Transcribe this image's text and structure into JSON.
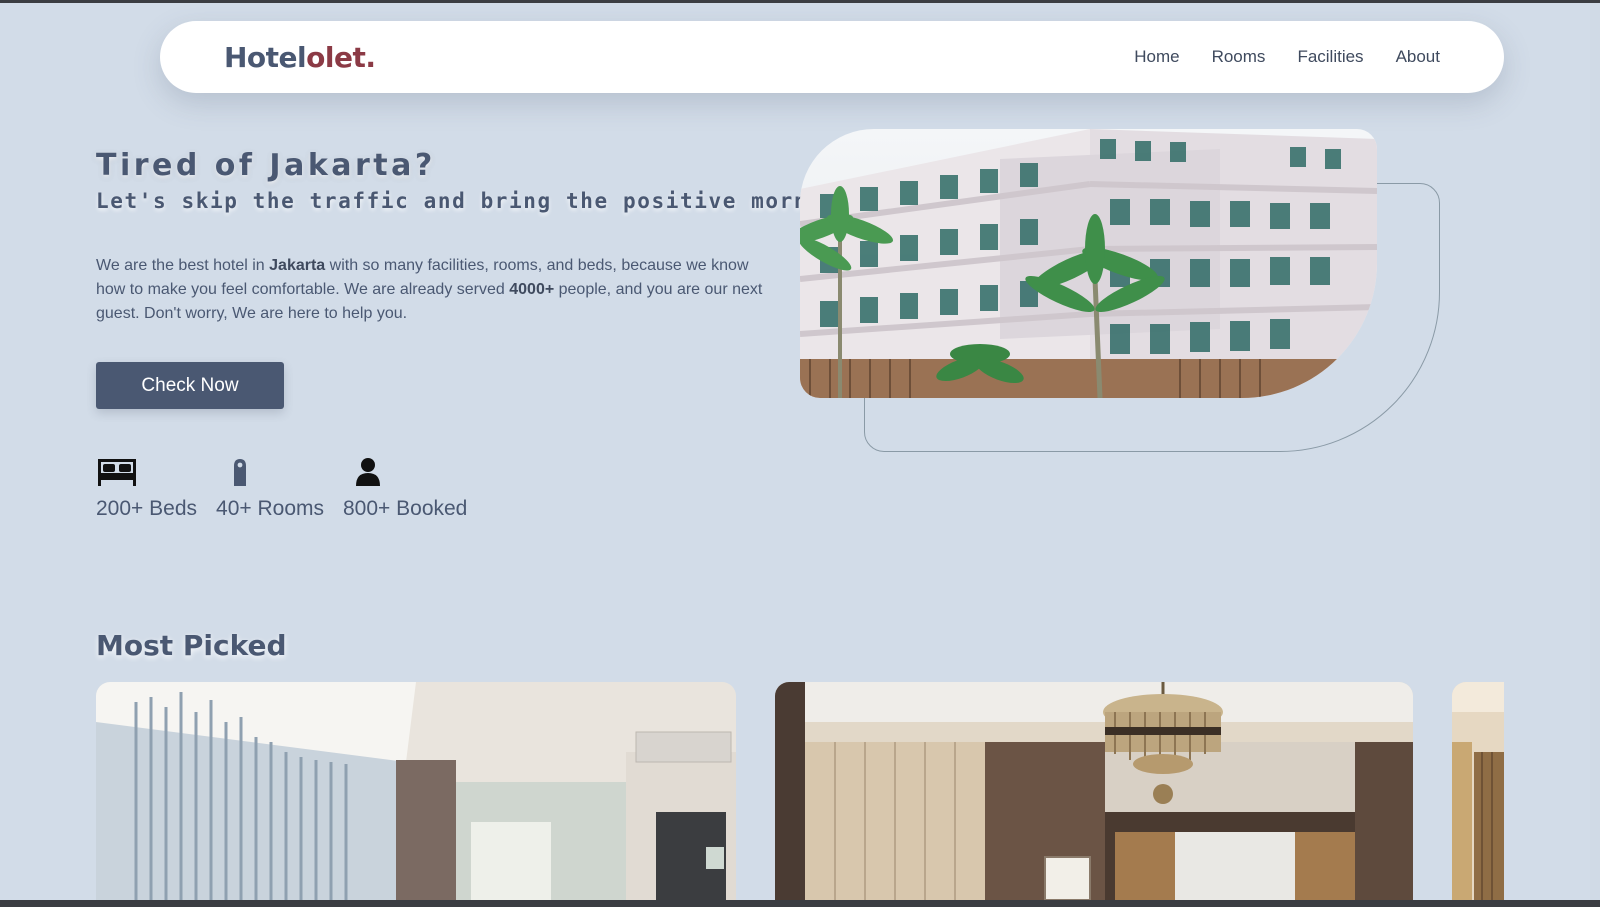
{
  "nav": {
    "brand_part1": "Hotel",
    "brand_part2": "olet.",
    "links": [
      "Home",
      "Rooms",
      "Facilities",
      "About"
    ]
  },
  "hero": {
    "title": "Tired of Jakarta?",
    "subtitle": "Let's skip the traffic and bring the positive morning",
    "desc_1": "We are the best hotel in ",
    "desc_bold_1": "Jakarta",
    "desc_2": " with so many facilities, rooms, and beds, because we know how to make you feel comfortable. We are already served ",
    "desc_bold_2": "4000+",
    "desc_3": " people, and you are our next guest. Don't worry, We are here to help you.",
    "cta_label": "Check Now",
    "stats": [
      {
        "icon": "bed-icon",
        "label": "200+ Beds"
      },
      {
        "icon": "door-hanger-icon",
        "label": "40+ Rooms"
      },
      {
        "icon": "user-icon",
        "label": "800+ Booked"
      }
    ]
  },
  "most_picked": {
    "title": "Most Picked"
  },
  "colors": {
    "background": "#d2dce8",
    "primary": "#4a5872",
    "brand_accent": "#8b3a45",
    "navbar": "#ffffff"
  }
}
